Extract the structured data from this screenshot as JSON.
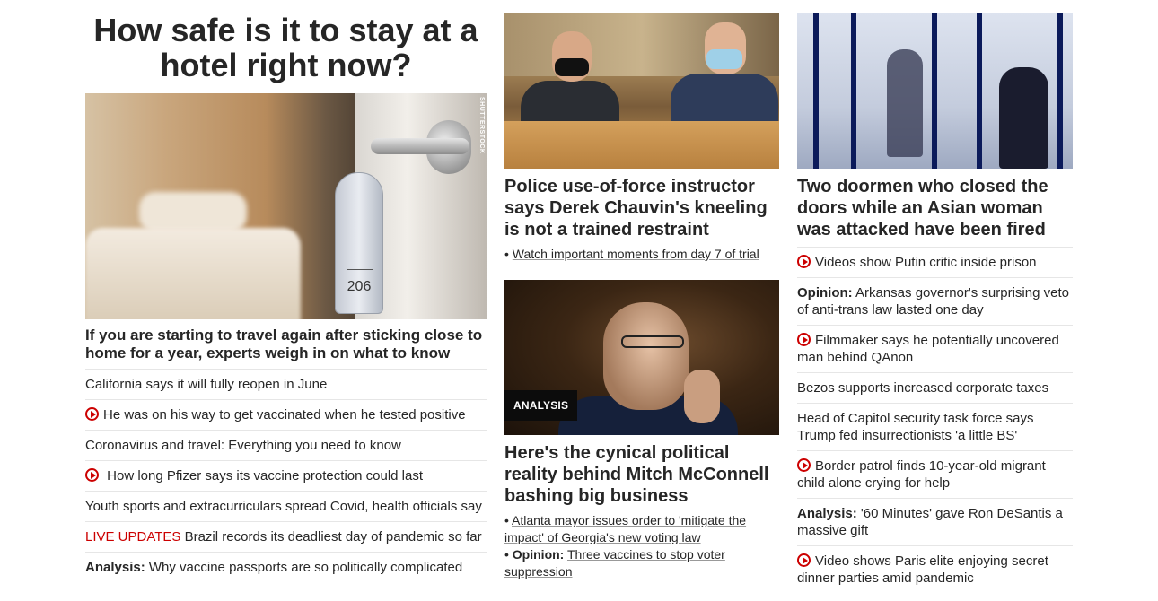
{
  "left": {
    "title": "How safe is it to stay at a hotel right now?",
    "image_credit": "SHUTTERSTOCK",
    "room_number": "206",
    "caption": "If you are starting to travel again after sticking close to home for a year, experts weigh in on what to know",
    "items": [
      {
        "text": "California says it will fully reopen in June"
      },
      {
        "text": "He was on his way to get vaccinated when he tested positive"
      },
      {
        "text": "Coronavirus and travel: Everything you need to know"
      },
      {
        "text": "How long Pfizer says its vaccine protection could last"
      },
      {
        "text": "Youth sports and extracurriculars spread Covid, health officials say"
      },
      {
        "prefix": "LIVE UPDATES",
        "text": "Brazil records its deadliest day of pandemic so far"
      },
      {
        "prefix": "Analysis:",
        "text": "Why vaccine passports are so politically complicated"
      }
    ]
  },
  "middle": {
    "story1": {
      "headline": "Police use-of-force instructor says Derek Chauvin's kneeling is not a trained restraint",
      "bullet": "Watch important moments from day 7 of trial"
    },
    "story2": {
      "badge": "ANALYSIS",
      "headline": "Here's the cynical political reality behind Mitch McConnell bashing big business",
      "bullet1": "Atlanta mayor issues order to 'mitigate the impact' of Georgia's new voting law",
      "bullet2_prefix": "Opinion:",
      "bullet2": "Three vaccines to stop voter suppression"
    }
  },
  "right": {
    "headline": "Two doormen who closed the doors while an Asian woman was attacked have been fired",
    "items": [
      {
        "text": "Videos show Putin critic inside prison"
      },
      {
        "prefix": "Opinion:",
        "text": "Arkansas governor's surprising veto of anti-trans law lasted one day"
      },
      {
        "text": "Filmmaker says he potentially uncovered man behind QAnon"
      },
      {
        "text": "Bezos supports increased corporate taxes"
      },
      {
        "text": "Head of Capitol security task force says Trump fed insurrectionists 'a little BS'"
      },
      {
        "text": "Border patrol finds 10-year-old migrant child alone crying for help"
      },
      {
        "prefix": "Analysis:",
        "text": "'60 Minutes' gave Ron DeSantis a massive gift"
      },
      {
        "text": "Video shows Paris elite enjoying secret dinner parties amid pandemic"
      }
    ]
  },
  "colors": {
    "accent_red": "#cc0000",
    "text": "#262626",
    "divider": "#e6e6e6"
  }
}
